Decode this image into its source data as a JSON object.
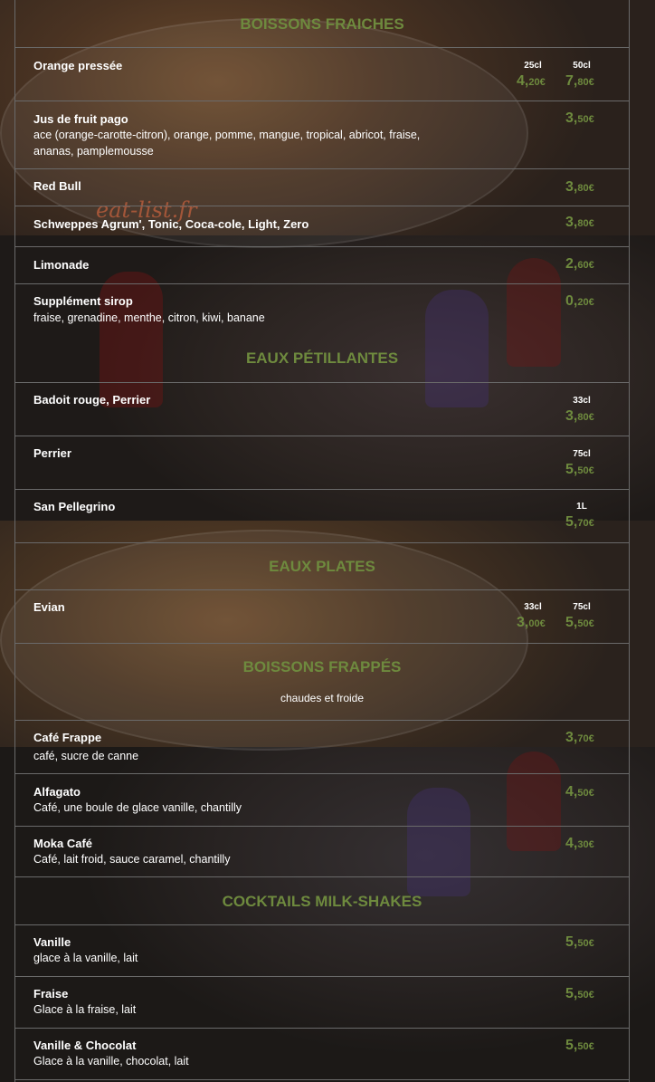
{
  "watermark": "eat-list.fr",
  "colors": {
    "accent": "#6e8a3e",
    "text": "#ffffff",
    "line": "#6a6a6a"
  },
  "sections": [
    {
      "title": "BOISSONS FRAICHES"
    },
    {
      "title": "EAUX PÉTILLANTES"
    },
    {
      "title": "EAUX PLATES"
    },
    {
      "title": "BOISSONS FRAPPÉS",
      "subtitle": "chaudes et froide"
    },
    {
      "title": "COCKTAILS MILK-SHAKES"
    }
  ],
  "items": [
    {
      "name": "Orange pressée",
      "desc": "",
      "prices": [
        {
          "size": "25cl",
          "int": "4,",
          "dec": "20€"
        },
        {
          "size": "50cl",
          "int": "7,",
          "dec": "80€"
        }
      ]
    },
    {
      "name": "Jus de fruit pago",
      "desc": "ace (orange-carotte-citron), orange, pomme, mangue, tropical, abricot, fraise, ananas, pamplemousse",
      "prices": [
        {
          "size": "",
          "int": "3,",
          "dec": "50€"
        }
      ]
    },
    {
      "name": "Red Bull",
      "desc": "",
      "prices": [
        {
          "size": "",
          "int": "3,",
          "dec": "80€"
        }
      ]
    },
    {
      "name": "Schweppes Agrum', Tonic, Coca-cole, Light, Zero",
      "desc": "",
      "prices": [
        {
          "size": "",
          "int": "3,",
          "dec": "80€"
        }
      ]
    },
    {
      "name": "Limonade",
      "desc": "",
      "prices": [
        {
          "size": "",
          "int": "2,",
          "dec": "60€"
        }
      ]
    },
    {
      "name": "Supplément sirop",
      "desc": "fraise, grenadine, menthe, citron, kiwi, banane",
      "prices": [
        {
          "size": "",
          "int": "0,",
          "dec": "20€"
        }
      ]
    },
    {
      "name": "Badoit rouge, Perrier",
      "desc": "",
      "prices": [
        {
          "size": "33cl",
          "int": "3,",
          "dec": "80€"
        }
      ]
    },
    {
      "name": "Perrier",
      "desc": "",
      "prices": [
        {
          "size": "75cl",
          "int": "5,",
          "dec": "50€"
        }
      ]
    },
    {
      "name": "San Pellegrino",
      "desc": "",
      "prices": [
        {
          "size": "1L",
          "int": "5,",
          "dec": "70€"
        }
      ]
    },
    {
      "name": "Evian",
      "desc": "",
      "prices": [
        {
          "size": "33cl",
          "int": "3,",
          "dec": "00€"
        },
        {
          "size": "75cl",
          "int": "5,",
          "dec": "50€"
        }
      ]
    },
    {
      "name": "Café Frappe",
      "desc": "café, sucre de canne",
      "prices": [
        {
          "size": "",
          "int": "3,",
          "dec": "70€"
        }
      ]
    },
    {
      "name": "Alfagato",
      "desc": "Café, une boule de glace vanille, chantilly",
      "prices": [
        {
          "size": "",
          "int": "4,",
          "dec": "50€"
        }
      ]
    },
    {
      "name": "Moka Café",
      "desc": "Café, lait froid, sauce caramel, chantilly",
      "prices": [
        {
          "size": "",
          "int": "4,",
          "dec": "30€"
        }
      ]
    },
    {
      "name": "Vanille",
      "desc": "glace à la vanille, lait",
      "prices": [
        {
          "size": "",
          "int": "5,",
          "dec": "50€"
        }
      ]
    },
    {
      "name": "Fraise",
      "desc": "Glace à la fraise, lait",
      "prices": [
        {
          "size": "",
          "int": "5,",
          "dec": "50€"
        }
      ]
    },
    {
      "name": "Vanille & Chocolat",
      "desc": "Glace à la vanille, chocolat, lait",
      "prices": [
        {
          "size": "",
          "int": "5,",
          "dec": "50€"
        }
      ]
    }
  ]
}
